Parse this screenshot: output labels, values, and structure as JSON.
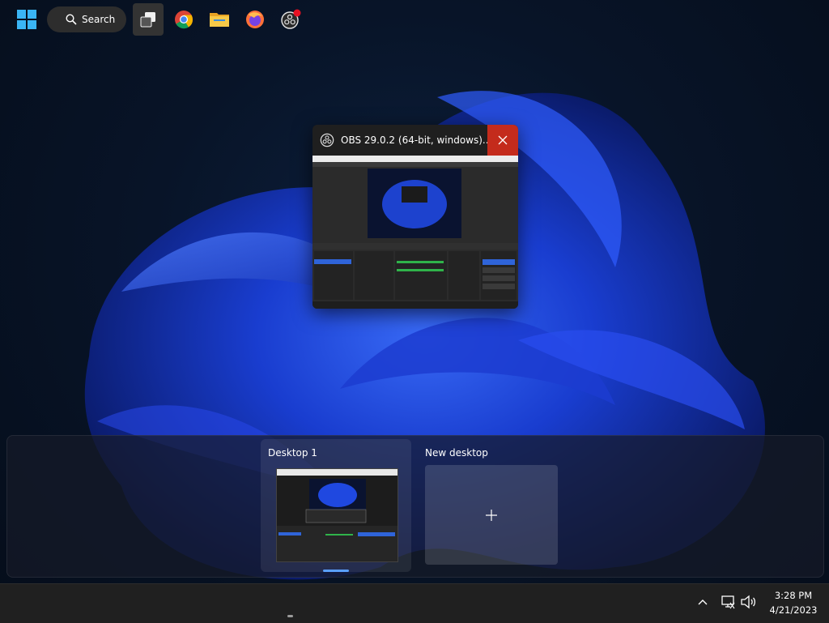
{
  "window_preview": {
    "title": "OBS 29.0.2 (64-bit, windows)...",
    "app_icon": "obs-icon",
    "close_icon": "close-icon"
  },
  "desktops": [
    {
      "label": "Desktop 1",
      "active": true
    },
    {
      "label": "New desktop",
      "icon": "plus-icon"
    }
  ],
  "taskbar": {
    "start_icon": "windows-start-icon",
    "search_label": "Search",
    "pinned": [
      "task-view-icon",
      "chrome-icon",
      "file-explorer-icon",
      "firefox-icon",
      "obs-icon"
    ],
    "tray": [
      "chevron-up-icon",
      "network-icon",
      "volume-icon"
    ],
    "time": "3:28 PM",
    "date": "4/21/2023"
  },
  "colors": {
    "close_hover": "#c42b1c",
    "accent": "#5aa0ff",
    "taskbar": "#202020"
  }
}
